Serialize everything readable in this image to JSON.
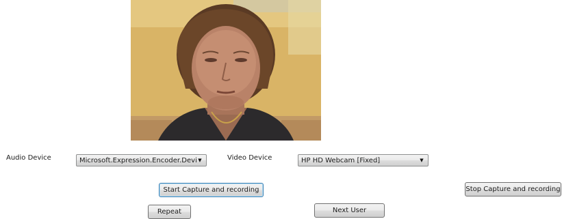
{
  "preview": {
    "icon": "webcam-feed"
  },
  "audio": {
    "label": "Audio Device",
    "selected": "Microsoft.Expression.Encoder.Devices"
  },
  "video": {
    "label": "Video Device",
    "selected": "HP HD Webcam [Fixed]"
  },
  "buttons": {
    "start": "Start Capture and recording",
    "stop": "Stop Capture and recording",
    "repeat": "Repeat",
    "next": "Next User"
  },
  "colors": {
    "focus_border": "#3c7fb1",
    "preview_bg": "#d8b064"
  }
}
